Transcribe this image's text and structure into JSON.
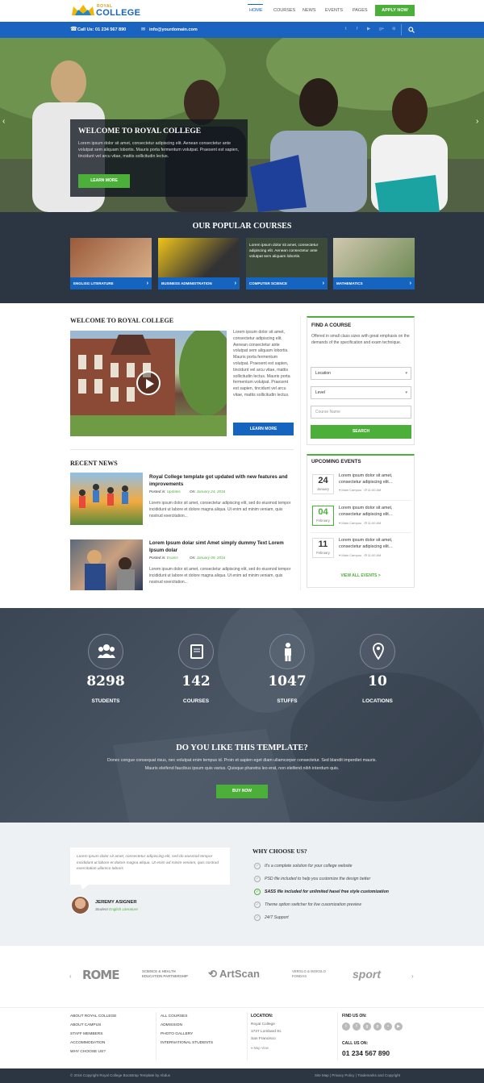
{
  "header": {
    "logo_top": "ROYAL",
    "logo_bottom": "COLLEGE",
    "nav": [
      "HOME",
      "COURSES",
      "NEWS",
      "EVENTS",
      "PAGES"
    ],
    "apply": "APPLY NOW"
  },
  "topbar": {
    "phone": "Call Us: 01 234 567 890",
    "email": "info@yourdomain.com"
  },
  "hero": {
    "title": "WELCOME TO ROYAL COLLEGE",
    "text": "Lorem ipsum dolor sit amet, consectetur adipiscing elit. Aenean consectetur ante volutpat sem aliquam lobortis. Mauris porta fermentum volutpat. Praesent est sapien, tincidunt vel arcu vitae, mattis sollicitudin lectus.",
    "button": "LEARN MORE"
  },
  "courses": {
    "title": "OUR POPULAR COURSES",
    "overlay_text": "Lorem ipsum dolor sit amet, consectetur adipiscing elit. Aenean consectetur ante volutpat sem aliquam lobortis.",
    "items": [
      "ENGLISG LITERATURE",
      "BUSINESS ADMINISTRATION",
      "COMPUTER SCIENCE",
      "MATHEMATICS"
    ]
  },
  "welcome": {
    "title": "WELCOME TO ROYAL COLLEGE",
    "text": "Lorem ipsum dolor sit amet, consectetur adipiscing elit. Aenean consectetur ante volutpat sem aliquam lobortis. Mauris porta fermentum volutpat. Praesent est sapien, tincidunt vel arcu vitae, mattis sollicitudin lectus. Mauris porta fermentum volutpat. Praesent est sapien, tincidunt vel arcu vitae, mattis sollicitudin lectus.",
    "button": "LEARN MORE"
  },
  "find_course": {
    "title": "FIND A COURSE",
    "text": "Offered in small class sizes with great emphasis on the demands of the specification and exam technique.",
    "location": "Location",
    "level": "Level",
    "course_placeholder": "Course Name",
    "search": "SEARCH"
  },
  "news": {
    "title": "RECENT NEWS",
    "posted_in": "Posted in:",
    "on": "On:",
    "items": [
      {
        "title": "Royal College template got updated with new features and improvements",
        "category": "Updates",
        "date": "January 24, 2016",
        "text": "Lorem ipsum dolor sit amet, consectetur adipiscing elit, sed do eiusmod tempor incididunt ut labore et dolore magna aliqua. Ut enim ad minim veniam, quis nostrud exercitation..."
      },
      {
        "title": "Lorem Ipsum dolar simt Amet simply dummy Text Lorem Ipsum dolar",
        "category": "Exams",
        "date": "January 09, 2016",
        "text": "Lorem ipsum dolor sit amet, consectetur adipiscing elit, sed do eiusmod tempor incididunt ut labore et dolore magna aliqua. Ut enim ad minim veniam, quis nostrud exercitation..."
      }
    ]
  },
  "events": {
    "title": "UPCOMING EVENTS",
    "items": [
      {
        "day": "24",
        "month": "January",
        "text": "Lorem ipsum dolor sit amet, consectetur adipiscing elit...",
        "place": "Main Campus",
        "time": "11:00 AM"
      },
      {
        "day": "04",
        "month": "February",
        "text": "Lorem ipsum dolor sit amet, consectetur adipiscing elit...",
        "place": "Main Campus",
        "time": "11:00 AM"
      },
      {
        "day": "11",
        "month": "February",
        "text": "Lorem ipsum dolor sit amet, consectetur adipiscing elit...",
        "place": "Main Campus",
        "time": "11:00 AM"
      }
    ],
    "view_all": "VIEW ALL EVENTS >"
  },
  "stats": [
    {
      "value": "8298",
      "label": "STUDENTS",
      "icon": "users-icon"
    },
    {
      "value": "142",
      "label": "COURSES",
      "icon": "book-icon"
    },
    {
      "value": "1047",
      "label": "STUFFS",
      "icon": "person-icon"
    },
    {
      "value": "10",
      "label": "LOCATIONS",
      "icon": "map-pin-icon"
    }
  ],
  "cta": {
    "title": "DO YOU LIKE THIS TEMPLATE?",
    "text1": "Donec congue consequat risus, nec volutpat enim tempus id. Proin et sapien eget diam ullamcorper consectetur. Sed blandit imperdiet mauris.",
    "text2": "Mauris eleifend faucibus ipsum quis varius. Quisque pharetra leo erat, non eleifend nibh interdum quis.",
    "button": "BUY NOW"
  },
  "testimonial": {
    "quote": "Lorem ipsum dolor sit amet, consectetur adipiscing elit, sed do eiusmod tempor incididunt ut labore et dolore magna aliqua. Ut enim ad minim veniam, quis nostrud exercitation ullamco laboris",
    "name": "JEREMY ASIGNER",
    "role_label": "Student",
    "role": "English Literature"
  },
  "why": {
    "title": "WHY CHOOSE US?",
    "items": [
      "It's a complete solution for your college website",
      "PSD file included to help you customize the design better",
      "SASS file included for unlimited hasel free style customization",
      "Theme option switcher for live cusomization preview",
      "24/7 Support"
    ]
  },
  "partners": [
    "ROME",
    "SCIENCE & HEALTH EDUCATION PARTNERSHIP",
    "ArtScan",
    "VERSLO & MOKSLO FONDAS",
    "sport"
  ],
  "footer": {
    "col1": [
      "ABOUT ROYAL COLLEGE",
      "ABOUT CAMPUS",
      "STAFF MEMBERS",
      "ACCOMMODATION",
      "WHY CHOOSE US?"
    ],
    "col2": [
      "ALL COURSES",
      "ADMISSION",
      "PHOTO GALLERY",
      "INTERNATIONAL STUDENTS"
    ],
    "location_title": "LOCATION:",
    "address": [
      "Royal College",
      "1727 Lombard St.",
      "San Francisco"
    ],
    "map_view": "Map View",
    "find_title": "FIND US ON:",
    "call_title": "CALL US ON:",
    "phone": "01 234 567 890",
    "copyright": "© 2016 Copyright Royal College Bootstrap Template by Abdus",
    "links": "Site Map | Privacy Policy | Trademarks and Copyright"
  },
  "colors": {
    "primary": "#1565c0",
    "accent": "#4caf3a",
    "dark": "#2b3642"
  }
}
